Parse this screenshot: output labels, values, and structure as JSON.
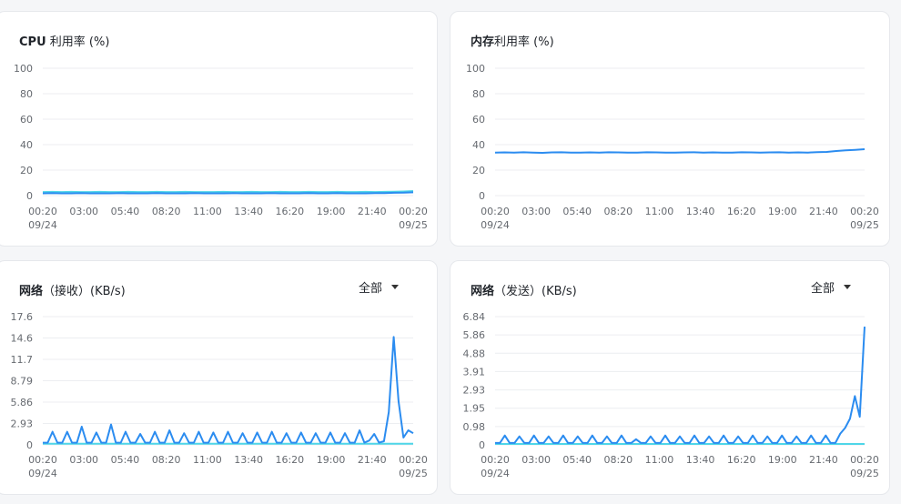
{
  "panels": [
    {
      "title_bold": "CPU",
      "title_rest": " 利用率 (%)"
    },
    {
      "title_bold": "内存",
      "title_rest": "利用率 (%)"
    },
    {
      "title_bold": "网络",
      "title_rest": "（接收）(KB/s)",
      "dropdown": "全部"
    },
    {
      "title_bold": "网络",
      "title_rest": "（发送）(KB/s)",
      "dropdown": "全部"
    }
  ],
  "colors": {
    "primary": "#2b8cf0",
    "secondary": "#4fd6e8",
    "grid": "#eceef1"
  },
  "chart_data": [
    {
      "type": "line",
      "title": "CPU 利用率 (%)",
      "x_ticks": [
        "00:20",
        "03:00",
        "05:40",
        "08:20",
        "11:00",
        "13:40",
        "16:20",
        "19:00",
        "21:40",
        "00:20"
      ],
      "x_dates": {
        "start": "09/24",
        "end": "09/25"
      },
      "y_ticks": [
        "0",
        "20",
        "40",
        "60",
        "80",
        "100"
      ],
      "ylim": [
        0,
        100
      ],
      "series": [
        {
          "color": "#4fd6e8",
          "values": [
            2.8,
            2.9,
            2.8,
            2.9,
            2.8,
            2.8,
            2.9,
            2.8,
            2.8,
            2.9,
            2.8,
            2.8,
            2.9,
            2.8,
            2.8,
            2.9,
            2.8,
            2.8,
            2.8,
            2.9,
            2.8,
            2.8,
            2.9,
            2.8,
            2.8,
            2.9,
            2.8,
            2.8,
            2.9,
            2.8,
            2.8,
            2.9,
            2.8,
            2.8,
            2.9,
            2.8,
            2.9,
            3.0,
            3.2,
            3.6
          ]
        },
        {
          "color": "#2b8cf0",
          "values": [
            1.8,
            1.9,
            1.8,
            1.8,
            1.9,
            1.8,
            1.8,
            1.8,
            1.9,
            1.8,
            1.8,
            1.8,
            1.9,
            1.8,
            1.8,
            1.8,
            1.9,
            1.8,
            1.8,
            1.8,
            1.9,
            1.8,
            1.8,
            1.8,
            1.9,
            1.8,
            1.8,
            1.8,
            1.9,
            1.8,
            1.8,
            1.9,
            1.8,
            1.8,
            1.8,
            1.9,
            2.0,
            2.2,
            2.3,
            2.6
          ]
        }
      ]
    },
    {
      "type": "line",
      "title": "内存利用率 (%)",
      "x_ticks": [
        "00:20",
        "03:00",
        "05:40",
        "08:20",
        "11:00",
        "13:40",
        "16:20",
        "19:00",
        "21:40",
        "00:20"
      ],
      "x_dates": {
        "start": "09/24",
        "end": "09/25"
      },
      "y_ticks": [
        "0",
        "20",
        "40",
        "60",
        "80",
        "100"
      ],
      "ylim": [
        0,
        100
      ],
      "series": [
        {
          "color": "#2b8cf0",
          "values": [
            33.8,
            33.9,
            33.7,
            34.0,
            33.8,
            33.6,
            33.9,
            34.0,
            33.8,
            33.7,
            33.9,
            33.8,
            34.0,
            33.9,
            33.7,
            33.8,
            34.0,
            33.9,
            33.8,
            33.7,
            33.9,
            34.0,
            33.8,
            33.9,
            33.8,
            33.7,
            34.0,
            33.9,
            33.8,
            33.9,
            34.0,
            33.8,
            33.9,
            33.8,
            34.1,
            34.3,
            35.0,
            35.6,
            35.9,
            36.4
          ]
        }
      ]
    },
    {
      "type": "line",
      "title": "网络（接收）(KB/s)",
      "x_ticks": [
        "00:20",
        "03:00",
        "05:40",
        "08:20",
        "11:00",
        "13:40",
        "16:20",
        "19:00",
        "21:40",
        "00:20"
      ],
      "x_dates": {
        "start": "09/24",
        "end": "09/25"
      },
      "y_ticks": [
        "0",
        "2.93",
        "5.86",
        "8.79",
        "11.7",
        "14.6",
        "17.6"
      ],
      "ylim": [
        0,
        17.6
      ],
      "series": [
        {
          "color": "#4fd6e8",
          "values": [
            0.15,
            0.15,
            0.15,
            0.15,
            0.15,
            0.15,
            0.15,
            0.15,
            0.15,
            0.15,
            0.15,
            0.15,
            0.15,
            0.15,
            0.15,
            0.15,
            0.15,
            0.15,
            0.15,
            0.15,
            0.15,
            0.15,
            0.15,
            0.15,
            0.15,
            0.15,
            0.15,
            0.15,
            0.15,
            0.15,
            0.15,
            0.15,
            0.15,
            0.15,
            0.15,
            0.15,
            0.15,
            0.15,
            0.15,
            0.15,
            0.15,
            0.15,
            0.15,
            0.15,
            0.15,
            0.15,
            0.15,
            0.15,
            0.15,
            0.15,
            0.15,
            0.15,
            0.15,
            0.15,
            0.15,
            0.15,
            0.15,
            0.15,
            0.15,
            0.15,
            0.15,
            0.15,
            0.15,
            0.15,
            0.15,
            0.15,
            0.15,
            0.15,
            0.15,
            0.15,
            0.15,
            0.15,
            0.15,
            0.15,
            0.15,
            0.15
          ]
        },
        {
          "color": "#2b8cf0",
          "values": [
            0.3,
            0.3,
            1.8,
            0.3,
            0.3,
            1.8,
            0.3,
            0.3,
            2.5,
            0.3,
            0.3,
            1.7,
            0.3,
            0.3,
            2.8,
            0.3,
            0.3,
            1.8,
            0.3,
            0.3,
            1.5,
            0.3,
            0.3,
            1.8,
            0.3,
            0.3,
            2.0,
            0.3,
            0.3,
            1.6,
            0.3,
            0.3,
            1.8,
            0.3,
            0.3,
            1.7,
            0.3,
            0.3,
            1.8,
            0.3,
            0.3,
            1.6,
            0.3,
            0.3,
            1.7,
            0.3,
            0.3,
            1.8,
            0.3,
            0.3,
            1.6,
            0.3,
            0.3,
            1.7,
            0.3,
            0.3,
            1.6,
            0.3,
            0.3,
            1.7,
            0.3,
            0.3,
            1.6,
            0.3,
            0.3,
            2.0,
            0.3,
            0.6,
            1.5,
            0.3,
            0.5,
            4.5,
            14.8,
            6.0,
            1.0,
            2.0,
            1.6
          ]
        }
      ]
    },
    {
      "type": "line",
      "title": "网络（发送）(KB/s)",
      "x_ticks": [
        "00:20",
        "03:00",
        "05:40",
        "08:20",
        "11:00",
        "13:40",
        "16:20",
        "19:00",
        "21:40",
        "00:20"
      ],
      "x_dates": {
        "start": "09/24",
        "end": "09/25"
      },
      "y_ticks": [
        "0",
        "0.98",
        "1.95",
        "2.93",
        "3.91",
        "4.88",
        "5.86",
        "6.84"
      ],
      "ylim": [
        0,
        6.84
      ],
      "series": [
        {
          "color": "#4fd6e8",
          "values": [
            0.05,
            0.05,
            0.05,
            0.05,
            0.05,
            0.05,
            0.05,
            0.05,
            0.05,
            0.05,
            0.05,
            0.05,
            0.05,
            0.05,
            0.05,
            0.05,
            0.05,
            0.05,
            0.05,
            0.05,
            0.05,
            0.05,
            0.05,
            0.05,
            0.05,
            0.05,
            0.05,
            0.05,
            0.05,
            0.05,
            0.05,
            0.05,
            0.05,
            0.05,
            0.05,
            0.05,
            0.05,
            0.05,
            0.05,
            0.05,
            0.05,
            0.05,
            0.05,
            0.05,
            0.05,
            0.05,
            0.05,
            0.05,
            0.05,
            0.05,
            0.05,
            0.05,
            0.05,
            0.05,
            0.05,
            0.05,
            0.05,
            0.05,
            0.05,
            0.05,
            0.05,
            0.05,
            0.05,
            0.05,
            0.05,
            0.05,
            0.05,
            0.05,
            0.05,
            0.05,
            0.05,
            0.05,
            0.05,
            0.05,
            0.05,
            0.05,
            0.05,
            0.05
          ]
        },
        {
          "color": "#2b8cf0",
          "values": [
            0.1,
            0.1,
            0.5,
            0.1,
            0.1,
            0.45,
            0.1,
            0.1,
            0.5,
            0.1,
            0.1,
            0.45,
            0.1,
            0.1,
            0.5,
            0.1,
            0.1,
            0.45,
            0.1,
            0.1,
            0.5,
            0.1,
            0.1,
            0.45,
            0.1,
            0.1,
            0.5,
            0.1,
            0.1,
            0.3,
            0.1,
            0.1,
            0.45,
            0.1,
            0.1,
            0.5,
            0.1,
            0.1,
            0.45,
            0.1,
            0.1,
            0.5,
            0.1,
            0.1,
            0.45,
            0.1,
            0.1,
            0.5,
            0.1,
            0.1,
            0.45,
            0.1,
            0.1,
            0.5,
            0.1,
            0.1,
            0.45,
            0.1,
            0.1,
            0.5,
            0.1,
            0.1,
            0.45,
            0.1,
            0.1,
            0.5,
            0.1,
            0.1,
            0.5,
            0.1,
            0.1,
            0.6,
            0.9,
            1.4,
            2.6,
            1.5,
            6.3
          ]
        }
      ]
    }
  ]
}
